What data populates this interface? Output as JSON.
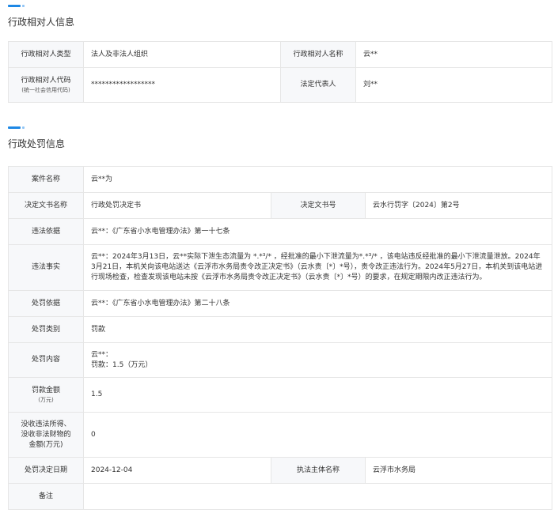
{
  "party": {
    "title": "行政相对人信息",
    "type_label": "行政相对人类型",
    "type_value": "法人及非法人组织",
    "name_label": "行政相对人名称",
    "name_value": "云**",
    "code_label": "行政相对人代码",
    "code_note": "(统一社会信用代码)",
    "code_value": "******************",
    "rep_label": "法定代表人",
    "rep_value": "刘**"
  },
  "penalty": {
    "title": "行政处罚信息",
    "case_name_label": "案件名称",
    "case_name_value": "云**为",
    "doc_name_label": "决定文书名称",
    "doc_name_value": "行政处罚决定书",
    "doc_no_label": "决定文书号",
    "doc_no_value": "云水行罚字〔2024〕第2号",
    "basis_label": "违法依据",
    "basis_value": "云**：《广东省小水电管理办法》第一十七条",
    "facts_label": "违法事实",
    "facts_value": "云**：2024年3月13日，云**实际下泄生态流量为 *.*³/* ，经批准的最小下泄流量为*.*³/* ，该电站违反经批准的最小下泄流量泄放。2024年3月21日，本机关向该电站送达《云浮市水务局责令改正决定书》（云水责〔*〕*号），责令改正违法行为。2024年5月27日，本机关到该电站进行现场检查，检查发现该电站未按《云浮市水务局责令改正决定书》（云水责〔*〕*号）的要求，在规定期限内改正违法行为。",
    "penalty_basis_label": "处罚依据",
    "penalty_basis_value": "云**：《广东省小水电管理办法》第二十八条",
    "category_label": "处罚类别",
    "category_value": "罚款",
    "content_label": "处罚内容",
    "content_line1": "云**：",
    "content_line2": "罚款：1.5（万元）",
    "fine_label": "罚款金额",
    "fine_unit": "(万元)",
    "fine_value": "1.5",
    "confisc_label_1": "没收违法所得、",
    "confisc_label_2": "没收非法财物的",
    "confisc_label_3": "金额(万元)",
    "confisc_value": "0",
    "date_label": "处罚决定日期",
    "date_value": "2024-12-04",
    "authority_label": "执法主体名称",
    "authority_value": "云浮市水务局",
    "remark_label": "备注",
    "remark_value": ""
  }
}
